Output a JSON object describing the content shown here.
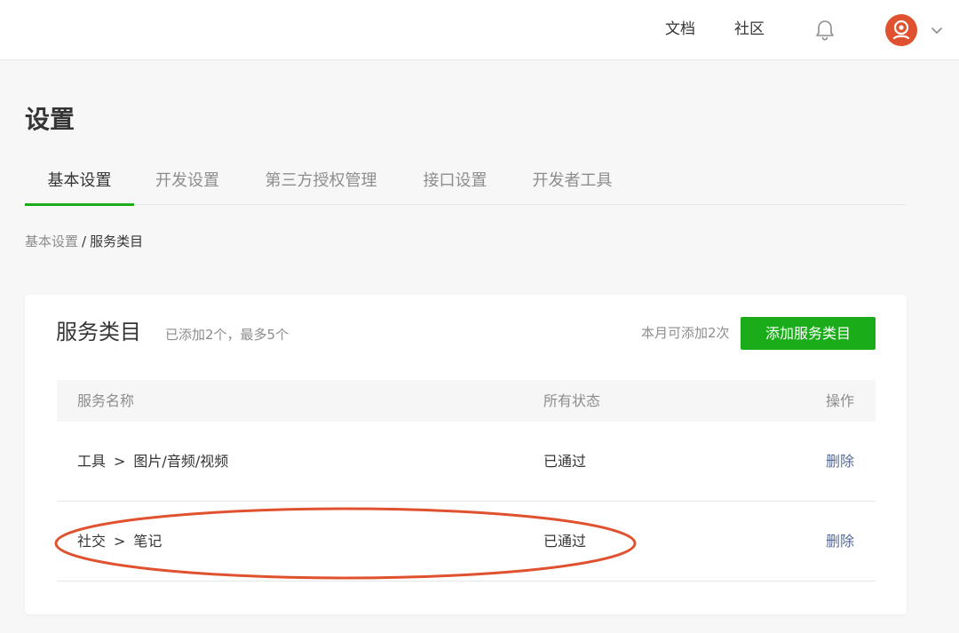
{
  "topbar": {
    "docs_label": "文档",
    "community_label": "社区",
    "icons": {
      "notification": "bell-icon",
      "avatar": "user-avatar",
      "menu": "chevron-down-icon"
    }
  },
  "page": {
    "title": "设置"
  },
  "tabs": [
    {
      "label": "基本设置",
      "active": true
    },
    {
      "label": "开发设置",
      "active": false
    },
    {
      "label": "第三方授权管理",
      "active": false
    },
    {
      "label": "接口设置",
      "active": false
    },
    {
      "label": "开发者工具",
      "active": false
    }
  ],
  "breadcrumb": {
    "parent": "基本设置",
    "separator": "/",
    "current": "服务类目"
  },
  "card": {
    "title": "服务类目",
    "subtitle": "已添加2个，最多5个",
    "month_limit": "本月可添加2次",
    "add_button": "添加服务类目"
  },
  "table": {
    "headers": {
      "name": "服务名称",
      "status": "所有状态",
      "operation": "操作"
    },
    "rows": [
      {
        "category": "工具",
        "arrow": ">",
        "subcategory": "图片/音频/视频",
        "status": "已通过",
        "action": "删除"
      },
      {
        "category": "社交",
        "arrow": ">",
        "subcategory": "笔记",
        "status": "已通过",
        "action": "删除"
      }
    ]
  },
  "colors": {
    "brand_green": "#1aad19",
    "link_blue": "#576b95",
    "annotation_red": "#e0522f"
  }
}
